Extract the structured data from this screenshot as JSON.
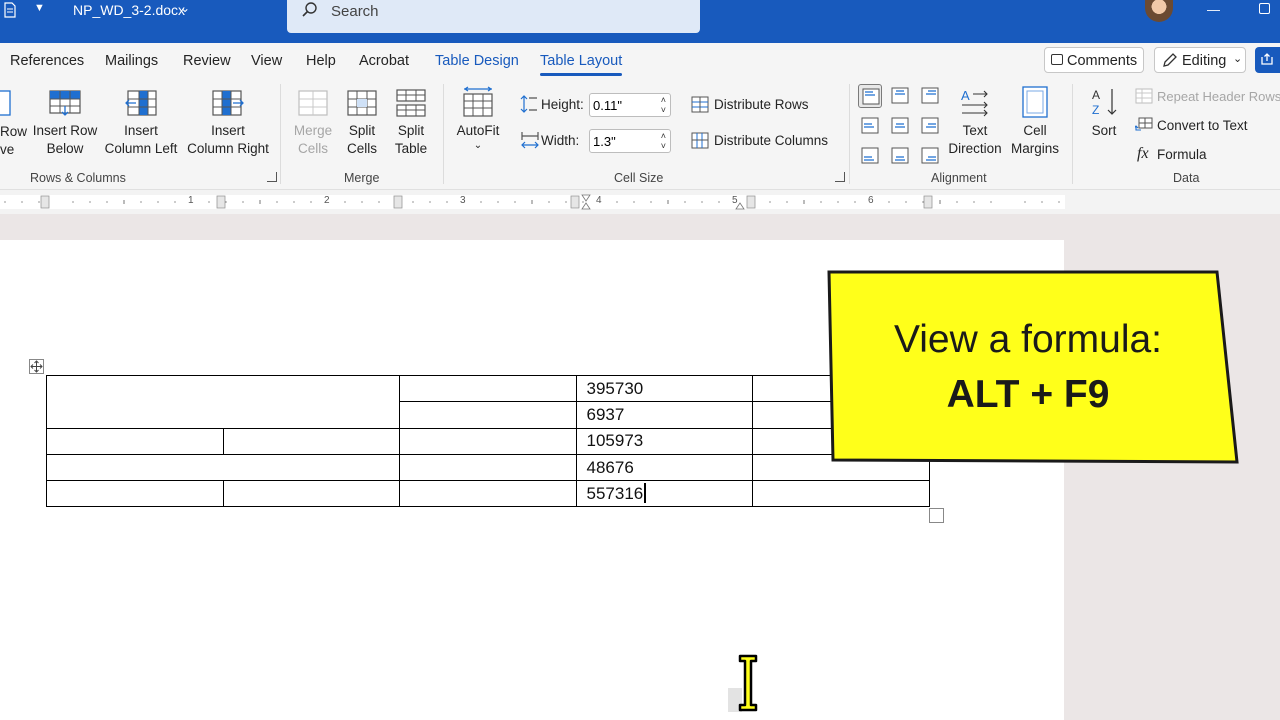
{
  "titlebar": {
    "filename": "NP_WD_3-2.docx",
    "search_placeholder": "Search"
  },
  "tabs": [
    {
      "label": "References"
    },
    {
      "label": "Mailings"
    },
    {
      "label": "Review"
    },
    {
      "label": "View"
    },
    {
      "label": "Help"
    },
    {
      "label": "Acrobat"
    },
    {
      "label": "Table Design"
    },
    {
      "label": "Table Layout"
    }
  ],
  "actions": {
    "comments": "Comments",
    "editing": "Editing"
  },
  "ribbon": {
    "rows_columns": {
      "partial_line1": "Row",
      "partial_line2": "ve",
      "insert_below_1": "Insert Row",
      "insert_below_2": "Below",
      "insert_left_1": "Insert",
      "insert_left_2": "Column Left",
      "insert_right_1": "Insert",
      "insert_right_2": "Column Right",
      "label": "Rows & Columns"
    },
    "merge": {
      "merge_cells_1": "Merge",
      "merge_cells_2": "Cells",
      "split_cells_1": "Split",
      "split_cells_2": "Cells",
      "split_table_1": "Split",
      "split_table_2": "Table",
      "label": "Merge"
    },
    "cell_size": {
      "autofit": "AutoFit",
      "height_label": "Height:",
      "height_value": "0.11\"",
      "width_label": "Width:",
      "width_value": "1.3\"",
      "distribute_rows": "Distribute Rows",
      "distribute_columns": "Distribute Columns",
      "label": "Cell Size"
    },
    "alignment": {
      "text_direction_1": "Text",
      "text_direction_2": "Direction",
      "cell_margins_1": "Cell",
      "cell_margins_2": "Margins",
      "label": "Alignment"
    },
    "data": {
      "sort": "Sort",
      "repeat_header_rows": "Repeat Header Rows",
      "convert_to_text": "Convert to Text",
      "formula": "Formula",
      "label": "Data"
    }
  },
  "ruler": {
    "numbers": [
      "1",
      "2",
      "3",
      "4",
      "5",
      "6"
    ]
  },
  "table": {
    "values": [
      "395730",
      "6937",
      "105973",
      "48676",
      "557316"
    ]
  },
  "callout": {
    "line1": "View a formula:",
    "line2": "ALT + F9",
    "fill_color": "#ffff1a"
  },
  "colors": {
    "brand": "#185abd"
  }
}
